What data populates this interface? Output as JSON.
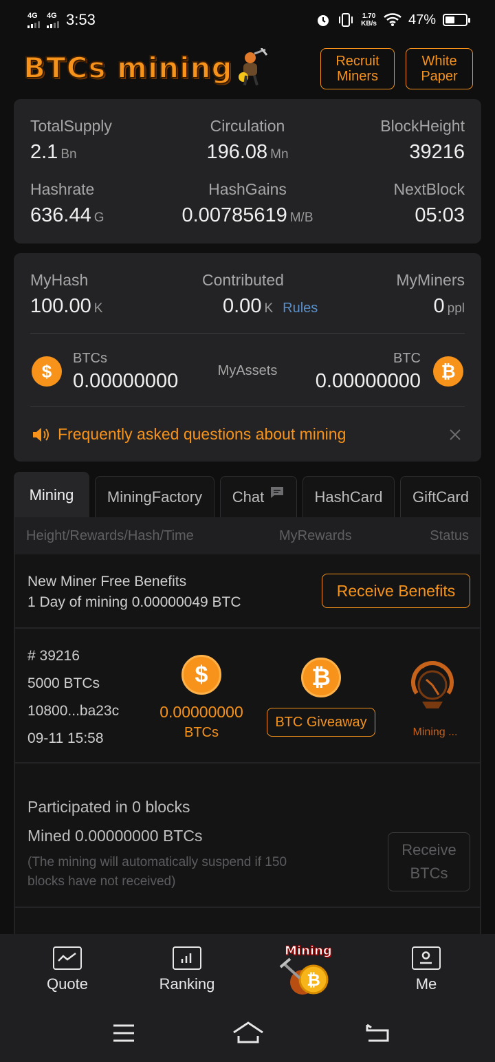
{
  "status_bar": {
    "network1": "4G",
    "network2": "4G",
    "time": "3:53",
    "speed_value": "1.70",
    "speed_unit": "KB/s",
    "battery": "47%"
  },
  "header": {
    "logo": "BTCs mining",
    "recruit_line1": "Recruit",
    "recruit_line2": "Miners",
    "paper_line1": "White",
    "paper_line2": "Paper"
  },
  "stats": {
    "total_supply": {
      "label": "TotalSupply",
      "value": "2.1",
      "unit": "Bn"
    },
    "circulation": {
      "label": "Circulation",
      "value": "196.08",
      "unit": "Mn"
    },
    "block_height": {
      "label": "BlockHeight",
      "value": "39216"
    },
    "hashrate": {
      "label": "Hashrate",
      "value": "636.44",
      "unit": "G"
    },
    "hash_gains": {
      "label": "HashGains",
      "value": "0.00785619",
      "unit": "M/B"
    },
    "next_block": {
      "label": "NextBlock",
      "value": "05:03"
    }
  },
  "my": {
    "my_hash": {
      "label": "MyHash",
      "value": "100.00",
      "unit": "K"
    },
    "contributed": {
      "label": "Contributed",
      "value": "0.00",
      "unit": "K",
      "link": "Rules"
    },
    "my_miners": {
      "label": "MyMiners",
      "value": "0",
      "unit": "ppl"
    },
    "btcs": {
      "label": "BTCs",
      "value": "0.00000000"
    },
    "my_assets": "MyAssets",
    "btc": {
      "label": "BTC",
      "value": "0.00000000"
    },
    "faq": "Frequently asked questions about mining"
  },
  "tabs": [
    "Mining",
    "MiningFactory",
    "Chat",
    "HashCard",
    "GiftCard"
  ],
  "table": {
    "col1": "Height/Rewards/Hash/Time",
    "col2": "MyRewards",
    "col3": "Status"
  },
  "benefits": {
    "title": "New Miner Free Benefits",
    "subtitle": "1 Day of mining 0.00000049 BTC",
    "button": "Receive Benefits"
  },
  "block": {
    "height": "# 39216",
    "reward": "5000 BTCs",
    "hash": "10800...ba23c",
    "time": "09-11 15:58",
    "my_reward": "0.00000000",
    "my_reward_unit": "BTCs",
    "giveaway": "BTC Giveaway",
    "status": "Mining ..."
  },
  "summary": {
    "participated": "Participated in 0 blocks",
    "mined": "Mined 0.00000000 BTCs",
    "note": "(The mining will automatically suspend if 150 blocks have not received)",
    "button_line1": "Receive",
    "button_line2": "BTCs"
  },
  "bottom_nav": {
    "quote": "Quote",
    "ranking": "Ranking",
    "mining": "Mining",
    "me": "Me"
  },
  "colors": {
    "accent": "#f7931a",
    "background": "#0f0f10",
    "card": "#232325"
  }
}
